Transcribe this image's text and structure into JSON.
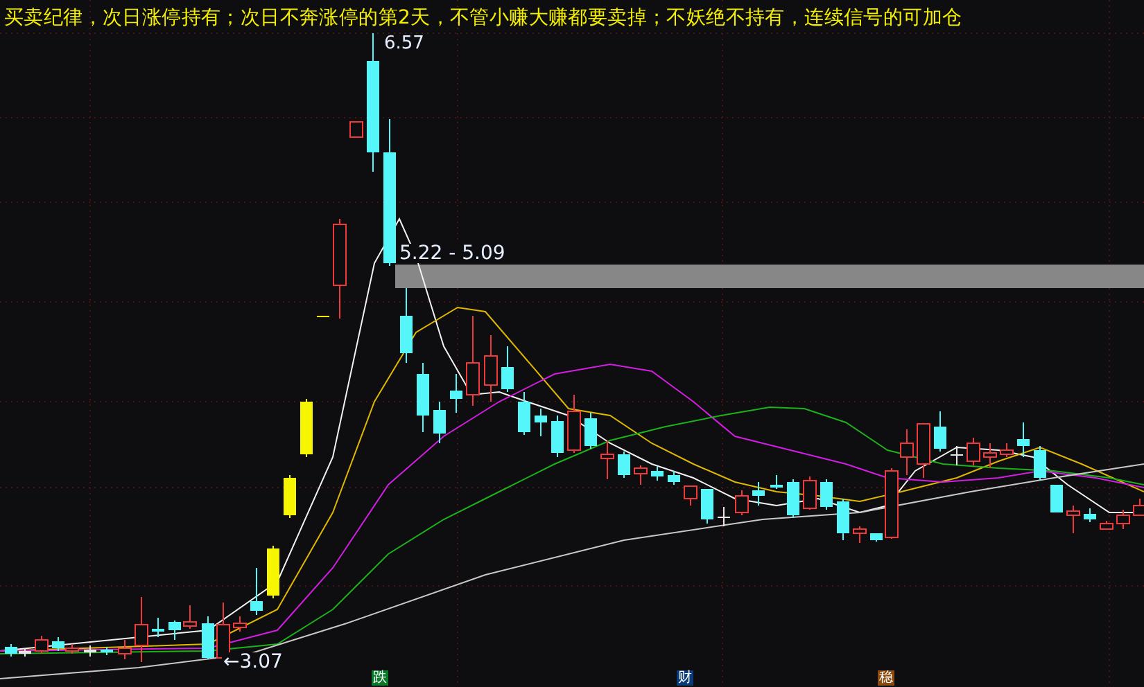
{
  "banner": {
    "text": "买卖纪律，次日涨停持有；次日不奔涨停的第2天，不管小赚大赚都要卖掉；不妖绝不持有，连续信号的可加仓"
  },
  "price_labels": {
    "high": "6.57",
    "range": "5.22 - 5.09",
    "low": "←3.07"
  },
  "markers": [
    {
      "text": "跌",
      "color": "#0a7a2a"
    },
    {
      "text": "财",
      "color": "#0a3a78"
    },
    {
      "text": "稳",
      "color": "#8a4a10"
    }
  ]
}
